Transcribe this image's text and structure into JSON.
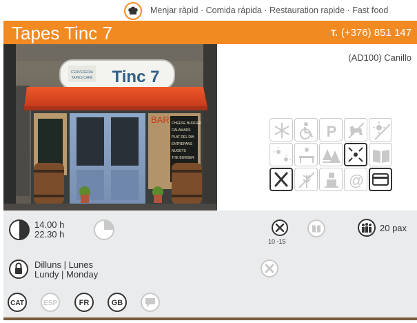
{
  "category": {
    "text": "Menjar ràpid · Comida rápida · Restauration rapide · Fast food",
    "icon": "chef-hat-icon"
  },
  "header": {
    "name": "Tapes Tinc 7",
    "tel_prefix": "T.",
    "tel": "(+376) 851 147",
    "address": "(AD100) Canillo"
  },
  "photo": {
    "sign": "Tinc 7",
    "sign_small": "CERVESERIA TAPES CAFÈ",
    "bar_label": "BAR",
    "board_text": [
      "CHEESE BURGER",
      "CALAMARS",
      "PLAT DEL DIA",
      "ENTREPANS",
      "NUGETS",
      "THE BURGER"
    ]
  },
  "services": [
    {
      "name": "air-conditioning-icon",
      "active": false
    },
    {
      "name": "wheelchair-icon",
      "active": false
    },
    {
      "name": "parking-icon",
      "active": false
    },
    {
      "name": "no-dogs-icon",
      "active": false
    },
    {
      "name": "terrace-sun-icon",
      "active": false
    },
    {
      "name": "sunny-terrace-icon",
      "active": false
    },
    {
      "name": "outdoor-seating-icon",
      "active": false
    },
    {
      "name": "mountain-view-icon",
      "active": false
    },
    {
      "name": "center-location-icon",
      "active": true
    },
    {
      "name": "menu-book-icon",
      "active": false
    },
    {
      "name": "cutlery-icon",
      "active": true
    },
    {
      "name": "gluten-free-icon",
      "active": false
    },
    {
      "name": "chef-icon",
      "active": false
    },
    {
      "name": "internet-icon",
      "active": false
    },
    {
      "name": "credit-card-icon",
      "active": true
    }
  ],
  "info": {
    "hours_line1": "14.00 h",
    "hours_line2": "22.30 h",
    "menu_price": "10 -15",
    "capacity": "20 pax",
    "closed_line1": "Dilluns | Lunes",
    "closed_line2": "Lundy | Monday",
    "languages": [
      "CAT",
      "ESP",
      "FR",
      "GB"
    ]
  },
  "colors": {
    "accent": "#f28a22",
    "panel": "#e9ebec",
    "icon_dark": "#333333",
    "icon_light": "#c9c9c9"
  }
}
